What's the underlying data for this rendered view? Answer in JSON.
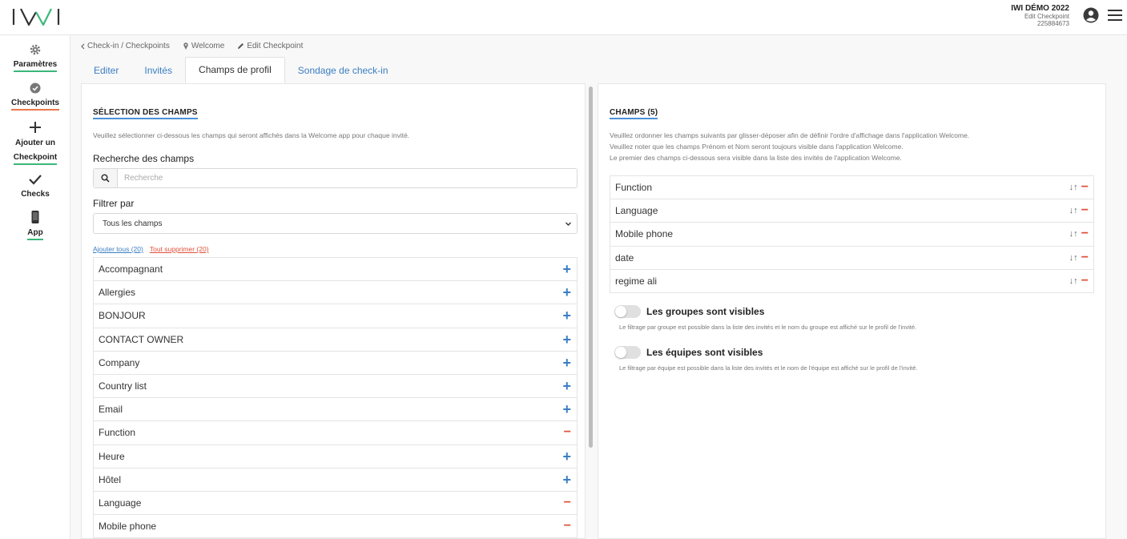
{
  "header": {
    "logo_text": "IWI",
    "event_title": "IWI DÉMO 2022",
    "event_subtitle": "Edit Checkpoint",
    "event_code": "225884673"
  },
  "sidebar": {
    "items": [
      {
        "label": "Paramètres",
        "icon": "gear-icon",
        "underline": "green"
      },
      {
        "label": "Checkpoints",
        "icon": "check-badge-icon",
        "underline": "orange"
      },
      {
        "label_line1": "Ajouter un",
        "label_line2": "Checkpoint",
        "icon": "plus-icon",
        "underline": "green"
      },
      {
        "label": "Checks",
        "icon": "checkmark-icon",
        "underline": "none"
      },
      {
        "label": "App",
        "icon": "phone-icon",
        "underline": "green"
      }
    ]
  },
  "breadcrumb": [
    {
      "label": "Check-in / Checkpoints",
      "icon": "chevron-left-icon"
    },
    {
      "label": "Welcome",
      "icon": "pin-icon"
    },
    {
      "label": "Edit Checkpoint",
      "icon": "pencil-icon"
    }
  ],
  "tabs": [
    {
      "label": "Editer",
      "active": false
    },
    {
      "label": "Invités",
      "active": false
    },
    {
      "label": "Champs de profil",
      "active": true
    },
    {
      "label": "Sondage de check-in",
      "active": false
    }
  ],
  "left": {
    "title": "SÉLECTION DES CHAMPS",
    "description": "Veuillez sélectionner ci-dessous les champs qui seront affichés dans la Welcome app pour chaque invité.",
    "search_label": "Recherche des champs",
    "search_placeholder": "Recherche",
    "filter_label": "Filtrer par",
    "filter_value": "Tous les champs",
    "add_all": "Ajouter tous (20)",
    "remove_all": "Tout supprimer (20)",
    "fields": [
      {
        "name": "Accompagnant",
        "selected": false
      },
      {
        "name": "Allergies",
        "selected": false
      },
      {
        "name": "BONJOUR",
        "selected": false
      },
      {
        "name": "CONTACT OWNER",
        "selected": false
      },
      {
        "name": "Company",
        "selected": false
      },
      {
        "name": "Country list",
        "selected": false
      },
      {
        "name": "Email",
        "selected": false
      },
      {
        "name": "Function",
        "selected": true
      },
      {
        "name": "Heure",
        "selected": false
      },
      {
        "name": "Hôtel",
        "selected": false
      },
      {
        "name": "Language",
        "selected": true
      },
      {
        "name": "Mobile phone",
        "selected": true
      }
    ]
  },
  "right": {
    "title": "CHAMPS (5)",
    "desc_line1": "Veuillez ordonner les champs suivants par glisser-déposer afin de définir l'ordre d'affichage dans l'application Welcome.",
    "desc_line2": "Veuillez noter que les champs Prénom et Nom seront toujours visible dans l'application Welcome.",
    "desc_line3": "Le premier des champs ci-dessous sera visible dans la liste des invités de l'application Welcome.",
    "ordered_fields": [
      "Function",
      "Language",
      "Mobile phone",
      "date",
      "regime ali"
    ],
    "groups_toggle_label": "Les groupes sont visibles",
    "groups_toggle_desc": "Le filtrage par groupe est possible dans la liste des invités et le nom du groupe est affiché sur le profil de l'invité.",
    "groups_toggle_on": false,
    "teams_toggle_label": "Les équipes sont visibles",
    "teams_toggle_desc": "Le filtrage par équipe est possible dans la liste des invités et le nom de l'équipe est affiché sur le profil de l'invité.",
    "teams_toggle_on": false
  },
  "colors": {
    "accent_blue": "#3a7ec2",
    "remove_red": "#e0503a",
    "underline_green": "#3bb779",
    "underline_orange": "#e8794a"
  }
}
